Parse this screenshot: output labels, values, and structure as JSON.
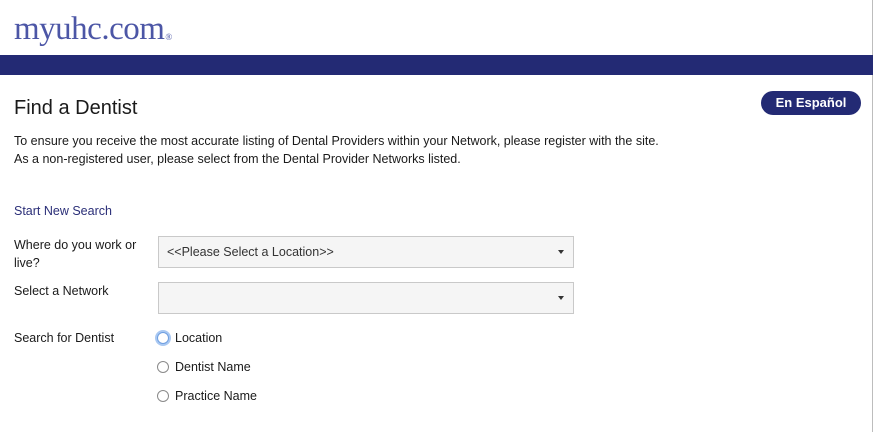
{
  "header": {
    "logo_text": "myuhc.com",
    "logo_mark": "®"
  },
  "page": {
    "title": "Find a Dentist",
    "language_button": "En Español",
    "intro_line1": "To ensure you receive the most accurate listing of Dental Providers within your Network, please register with the site.",
    "intro_line2": "As a non-registered user, please select from the Dental Provider Networks listed."
  },
  "search": {
    "start_new": "Start New Search",
    "location_label": "Where do you work or live?",
    "location_value": "<<Please Select a Location>>",
    "network_label": "Select a Network",
    "network_value": "",
    "search_for_label": "Search for Dentist",
    "options": [
      {
        "label": "Location",
        "checked": false,
        "focused": true
      },
      {
        "label": "Dentist Name",
        "checked": false,
        "focused": false
      },
      {
        "label": "Practice Name",
        "checked": false,
        "focused": false
      }
    ]
  },
  "colors": {
    "brand_navy": "#232a74",
    "logo_blue": "#4c56a6",
    "link": "#2b2f78"
  }
}
